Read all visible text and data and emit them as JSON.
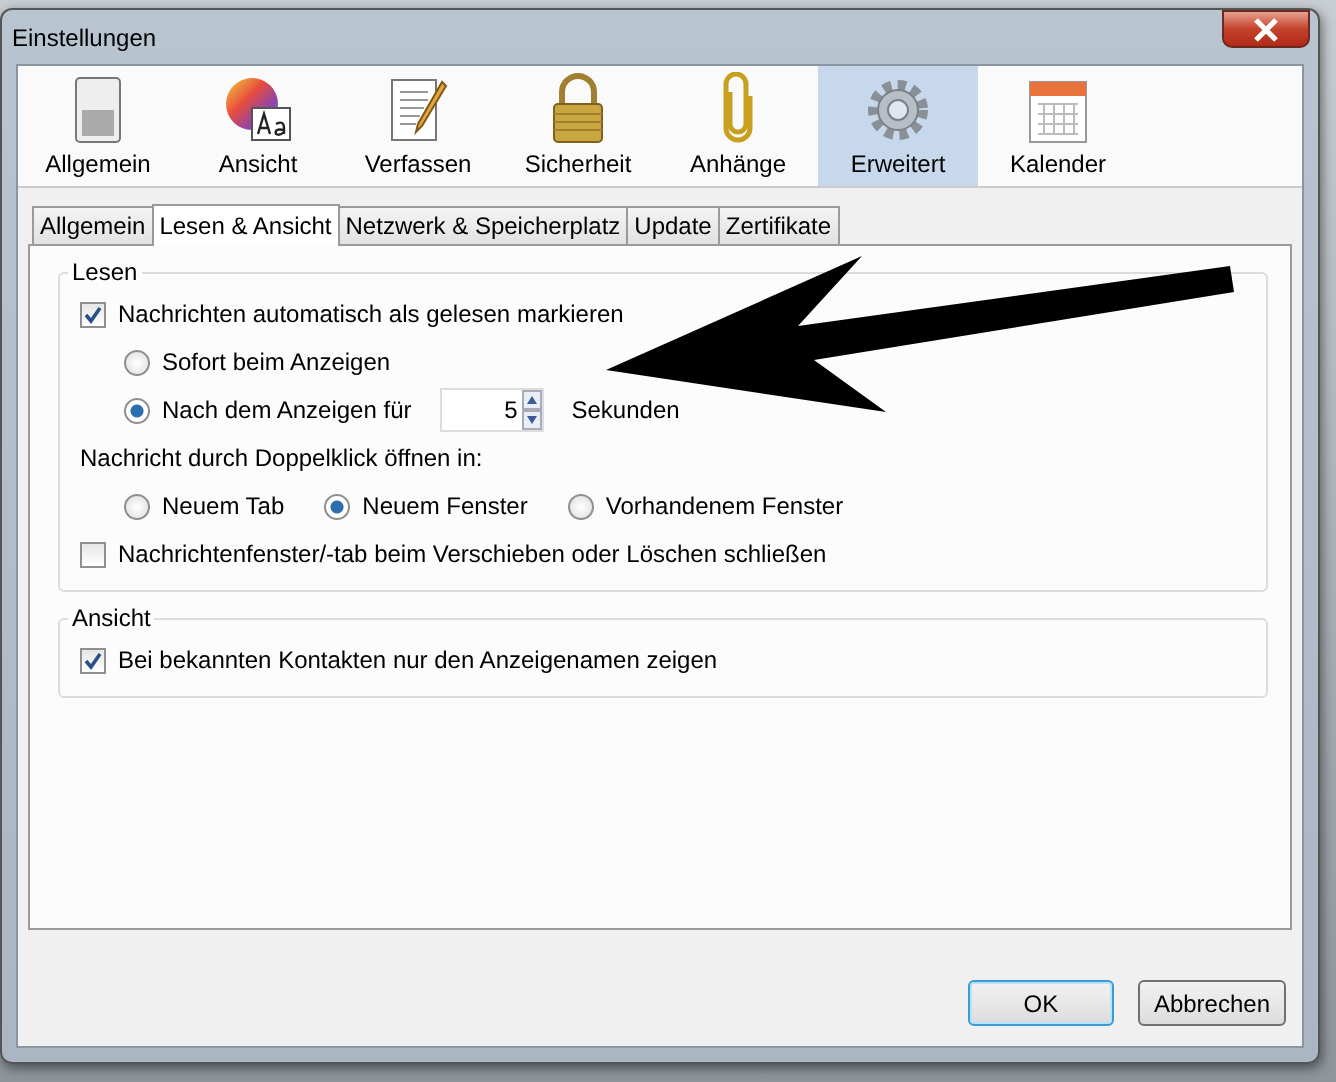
{
  "window": {
    "title": "Einstellungen"
  },
  "categories": [
    {
      "label": "Allgemein",
      "kind": "switch",
      "selected": false
    },
    {
      "label": "Ansicht",
      "kind": "palette",
      "selected": false
    },
    {
      "label": "Verfassen",
      "kind": "document",
      "selected": false
    },
    {
      "label": "Sicherheit",
      "kind": "lock",
      "selected": false
    },
    {
      "label": "Anhänge",
      "kind": "clip",
      "selected": false
    },
    {
      "label": "Erweitert",
      "kind": "gear",
      "selected": true
    },
    {
      "label": "Kalender",
      "kind": "calendar",
      "selected": false
    }
  ],
  "tabs": [
    {
      "label": "Allgemein",
      "selected": false
    },
    {
      "label": "Lesen & Ansicht",
      "selected": true
    },
    {
      "label": "Netzwerk & Speicherplatz",
      "selected": false
    },
    {
      "label": "Update",
      "selected": false
    },
    {
      "label": "Zertifikate",
      "selected": false
    }
  ],
  "groups": [
    {
      "title": "Lesen",
      "items": [
        {
          "kind": "checkbox",
          "label": "Nachrichten automatisch als gelesen markieren",
          "checked": true
        },
        {
          "kind": "radio",
          "label": "Sofort beim Anzeigen",
          "selected": false
        },
        {
          "kind": "radio-spin",
          "label": "Nach dem Anzeigen für",
          "selected": true,
          "value": "5",
          "unit": "Sekunden"
        },
        {
          "kind": "label",
          "label": "Nachricht durch Doppelklick öffnen in:"
        },
        {
          "kind": "radio-row",
          "options": [
            {
              "label": "Neuem Tab",
              "selected": false
            },
            {
              "label": "Neuem Fenster",
              "selected": true
            },
            {
              "label": "Vorhandenem Fenster",
              "selected": false
            }
          ]
        },
        {
          "kind": "checkbox",
          "label": "Nachrichtenfenster/-tab beim Verschieben oder Löschen schließen",
          "checked": false
        }
      ]
    },
    {
      "title": "Ansicht",
      "items": [
        {
          "kind": "checkbox",
          "label": "Bei bekannten Kontakten nur den Anzeigenamen zeigen",
          "checked": true
        }
      ]
    }
  ],
  "buttons": [
    {
      "label": "OK",
      "kind": "default"
    },
    {
      "label": "Abbrechen",
      "kind": "normal"
    }
  ]
}
